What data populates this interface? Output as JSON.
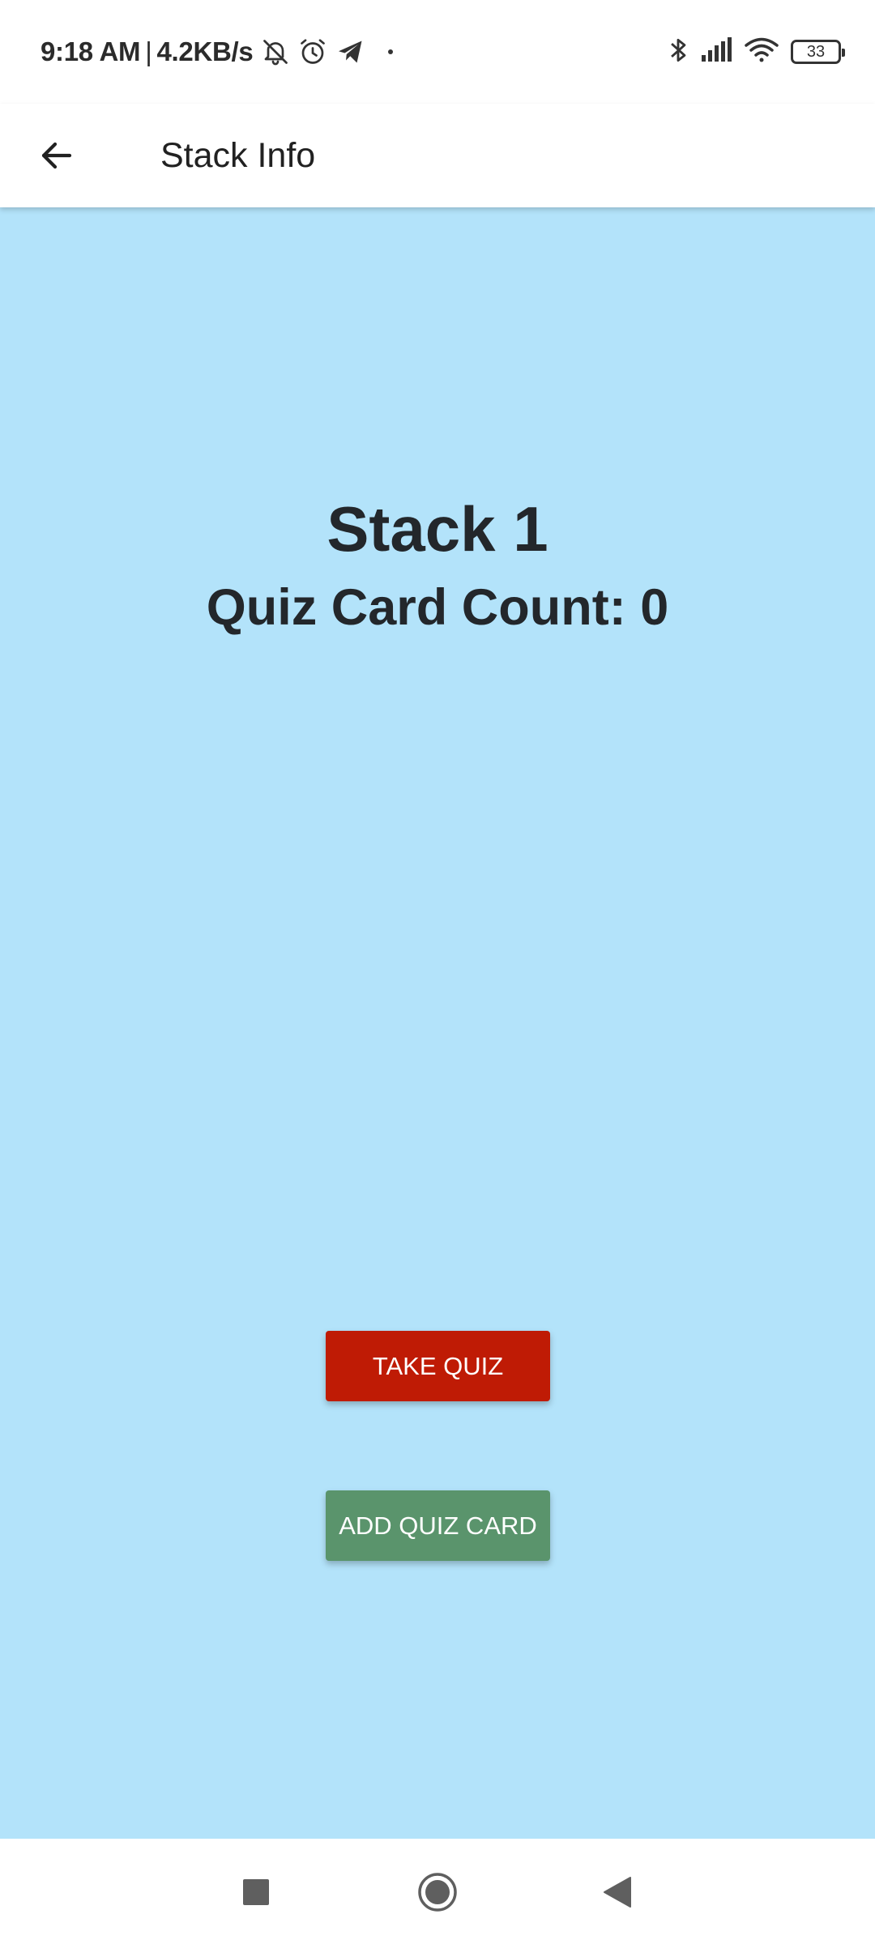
{
  "status_bar": {
    "time": "9:18 AM",
    "separator": "|",
    "speed": "4.2KB/s",
    "battery": "33",
    "icons": [
      "bell-off-icon",
      "alarm-icon",
      "telegram-icon",
      "dot-icon",
      "bluetooth-icon",
      "signal-icon",
      "wifi-icon",
      "battery-icon"
    ]
  },
  "app_bar": {
    "title": "Stack Info",
    "back_icon": "arrow-back-icon"
  },
  "main": {
    "stack_name": "Stack 1",
    "card_count": "Quiz Card Count: 0",
    "take_quiz_label": "TAKE QUIZ",
    "add_card_label": "ADD QUIZ CARD"
  },
  "nav_bar": {
    "icons": [
      "recents-square-icon",
      "home-circle-icon",
      "back-triangle-icon"
    ]
  },
  "colors": {
    "background": "#b3e3fa",
    "take_quiz": "#bf1b05",
    "add_card": "#5a946c",
    "text": "#23272b"
  }
}
